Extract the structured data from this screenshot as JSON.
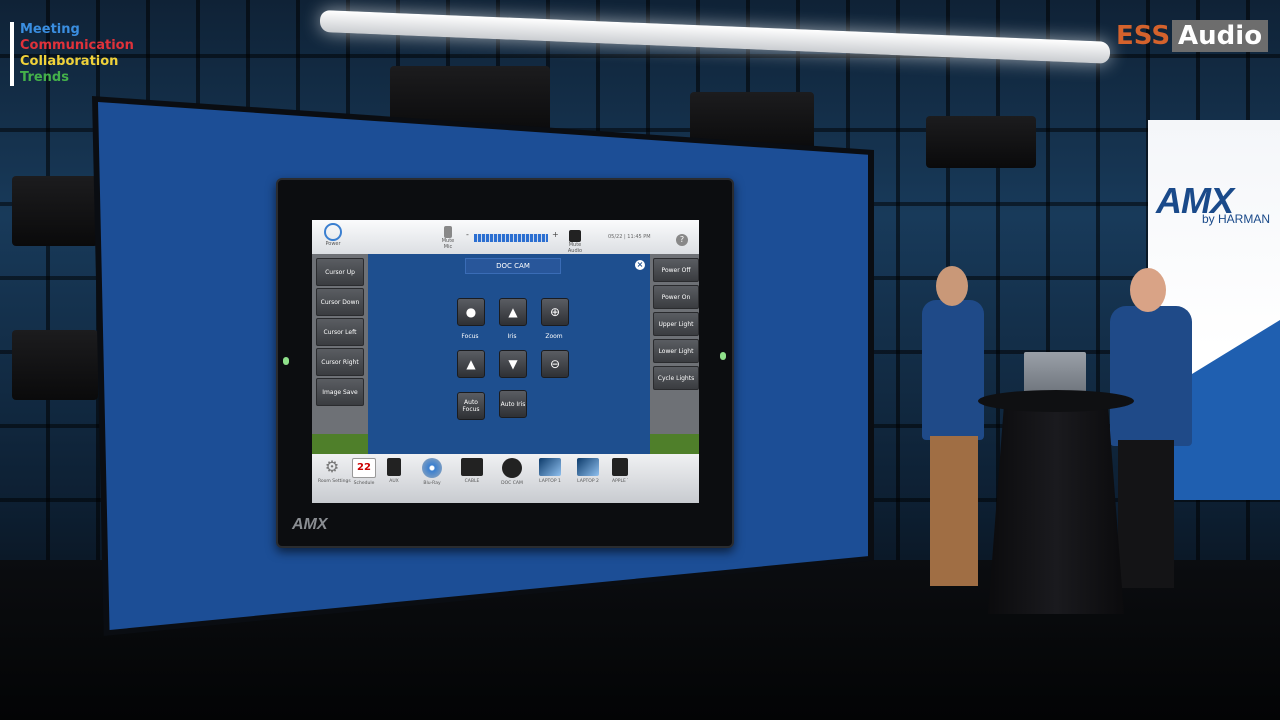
{
  "overlay_tags": [
    {
      "label": "Meeting",
      "color": "#3a8ee0"
    },
    {
      "label": "Communication",
      "color": "#e0323a"
    },
    {
      "label": "Collaboration",
      "color": "#f0d23a"
    },
    {
      "label": "Trends",
      "color": "#44b04a"
    }
  ],
  "brand": {
    "ess": "ESS",
    "audio": "Audio"
  },
  "banner": {
    "logo": "AMX",
    "sub": "by HARMAN"
  },
  "panel": {
    "bezel_logo": "AMX",
    "topbar": {
      "power_label": "Power",
      "mute_mic_label": "Mute Mic",
      "vol_minus": "-",
      "vol_plus": "+",
      "volume_level": 0.75,
      "mute_audio_label": "Mute Audio",
      "datetime": "05/22 | 11:45 PM",
      "help": "?"
    },
    "title": "DOC CAM",
    "close": "×",
    "left_buttons": [
      "Cursor Up",
      "Cursor Down",
      "Cursor Left",
      "Cursor Right",
      "Image Save"
    ],
    "right_buttons": [
      "Power Off",
      "Power On",
      "Upper Light",
      "Lower Light",
      "Cycle Lights"
    ],
    "camera_labels": {
      "focus": "Focus",
      "iris": "Iris",
      "zoom": "Zoom",
      "auto_focus": "Auto Focus",
      "auto_iris": "Auto Iris"
    },
    "sources": [
      {
        "label": "Room Settings",
        "icon": "gear-icon"
      },
      {
        "label": "Schedule",
        "icon": "calendar-icon",
        "day": "22"
      },
      {
        "label": "AUX",
        "icon": "aux-icon"
      },
      {
        "label": "Blu-Ray",
        "icon": "disc-icon"
      },
      {
        "label": "CABLE",
        "icon": "tv-icon"
      },
      {
        "label": "DOC CAM",
        "icon": "camera-icon"
      },
      {
        "label": "LAPTOP 1",
        "icon": "laptop-icon"
      },
      {
        "label": "LAPTOP 2",
        "icon": "laptop-icon"
      },
      {
        "label": "APPLE TV",
        "icon": "monitor-icon"
      }
    ]
  }
}
